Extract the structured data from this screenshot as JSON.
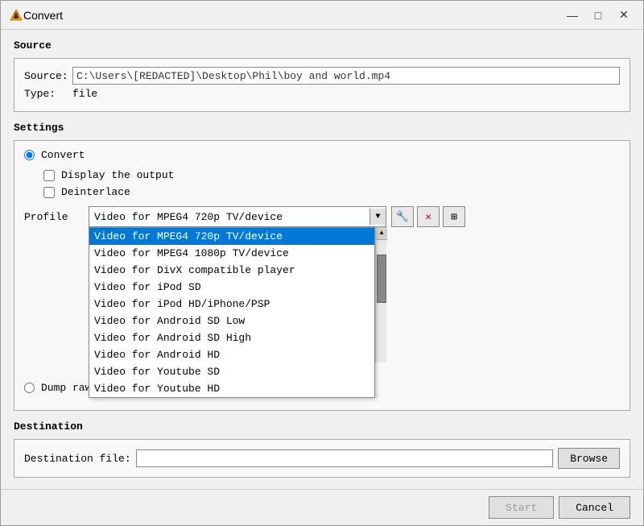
{
  "window": {
    "title": "Convert",
    "icon": "vlc"
  },
  "titlebar": {
    "minimize": "—",
    "maximize": "□",
    "close": "✕"
  },
  "source_section": {
    "title": "Source",
    "source_label": "Source:",
    "source_value": "C:\\Users\\[REDACTED]\\Desktop\\Phil\\boy and world.mp4",
    "type_label": "Type:",
    "type_value": "file"
  },
  "settings_section": {
    "title": "Settings",
    "convert_radio_label": "Convert",
    "display_output_label": "Display the output",
    "deinterlace_label": "Deinterlace",
    "profile_label": "Profile",
    "profile_selected": "Video for MPEG4 720p TV/device",
    "profile_options": [
      "Video for MPEG4 720p TV/device",
      "Video for MPEG4 1080p TV/device",
      "Video for DivX compatible player",
      "Video for iPod SD",
      "Video for iPod HD/iPhone/PSP",
      "Video for Android SD Low",
      "Video for Android SD High",
      "Video for Android HD",
      "Video for Youtube SD",
      "Video for Youtube HD"
    ],
    "tool_wrench": "🔧",
    "tool_delete": "✕",
    "tool_copy": "⊞",
    "dump_radio_label": "Dump raw input"
  },
  "destination_section": {
    "title": "Destination",
    "dest_file_label": "Destination file:",
    "dest_file_value": "",
    "browse_label": "Browse"
  },
  "bottom_bar": {
    "start_label": "Start",
    "cancel_label": "Cancel"
  }
}
